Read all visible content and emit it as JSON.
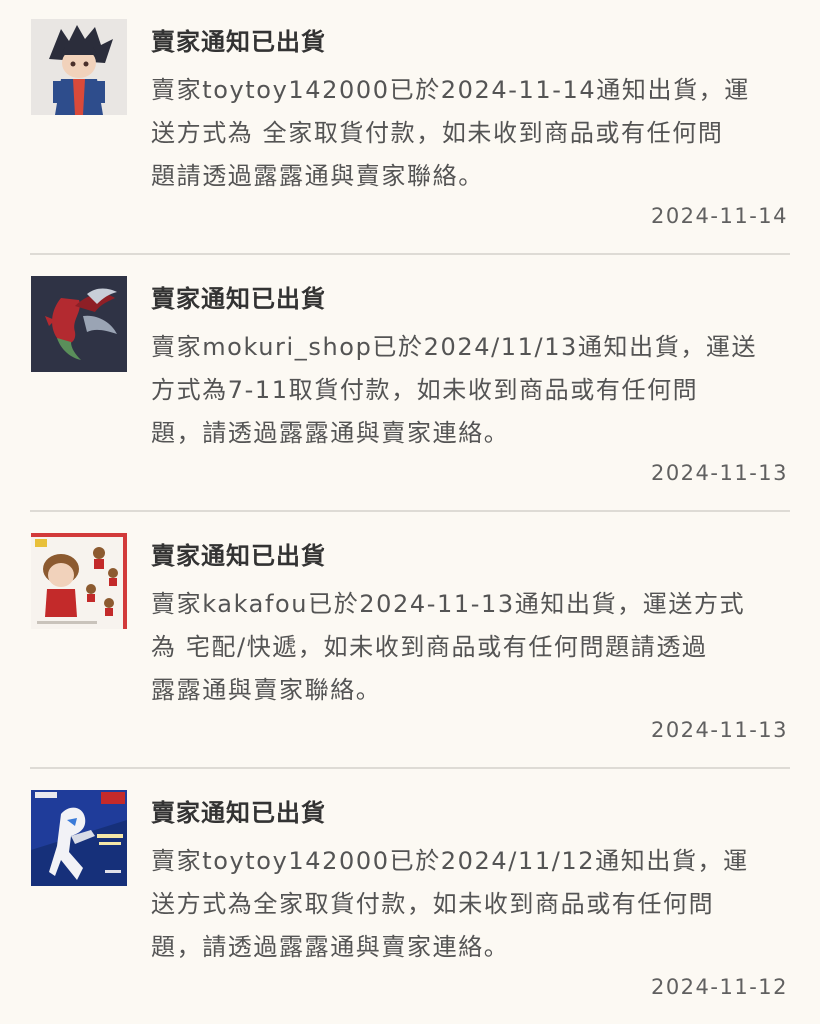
{
  "notifications": [
    {
      "title": "賣家通知已出貨",
      "thumb": "anime-figure-dark-hair-blue-jacket",
      "lines": [
        "賣家toytoy142000已於2024-11-14通知出貨，運",
        "送方式為 全家取貨付款，如未收到商品或有任何問",
        "題請透過露露通與賣家聯絡。"
      ],
      "date": "2024-11-14"
    },
    {
      "title": "賣家通知已出貨",
      "thumb": "red-dragon-figure",
      "lines": [
        "賣家mokuri_shop已於2024/11/13通知出貨，運送",
        "方式為7-11取貨付款，如未收到商品或有任何問",
        "題，請透過露露通與賣家連絡。"
      ],
      "date": "2024-11-13"
    },
    {
      "title": "賣家通知已出貨",
      "thumb": "nendoroid-box-red-jacket",
      "lines": [
        "賣家kakafou已於2024-11-13通知出貨，運送方式",
        "為 宅配/快遞，如未收到商品或有任何問題請透過",
        "露露通與賣家聯絡。"
      ],
      "date": "2024-11-13"
    },
    {
      "title": "賣家通知已出貨",
      "thumb": "white-hero-figure-blue-poster",
      "lines": [
        "賣家toytoy142000已於2024/11/12通知出貨，運",
        "送方式為全家取貨付款，如未收到商品或有任何問",
        "題，請透過露露通與賣家連絡。"
      ],
      "date": "2024-11-12"
    }
  ]
}
